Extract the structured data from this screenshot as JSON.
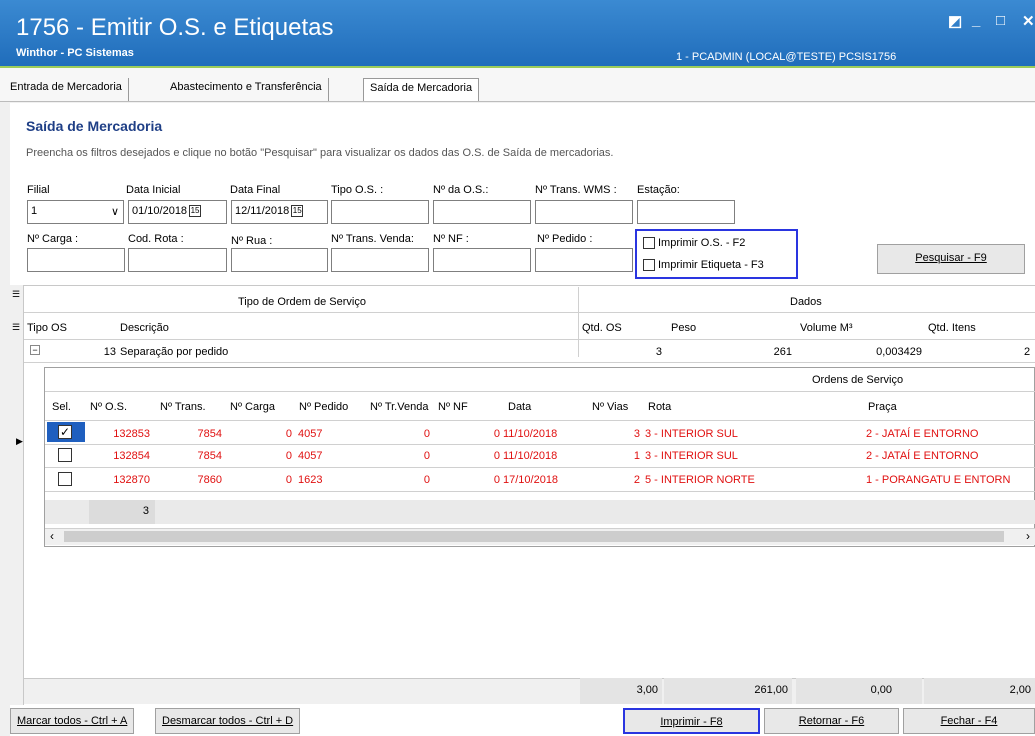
{
  "window": {
    "title": "1756 - Emitir O.S. e Etiquetas",
    "subtitle": "Winthor - PC Sistemas",
    "user_info": "1 - PCADMIN (LOCAL@TESTE)  PCSIS1756",
    "btn_min": "_",
    "btn_max": "□",
    "btn_close": "✕",
    "btn_restore": "◩"
  },
  "tabs": [
    "Entrada de Mercadoria",
    "Abastecimento e Transferência",
    "Saída de Mercadoria"
  ],
  "section": {
    "title": "Saída de Mercadoria",
    "description": "Preencha os filtros desejados e clique no botão \"Pesquisar\" para visualizar os dados das O.S. de Saída de mercadorias."
  },
  "filters": {
    "filial_label": "Filial",
    "filial_value": "1",
    "data_inicial_label": "Data Inicial",
    "data_inicial_value": "01/10/2018",
    "data_final_label": "Data Final",
    "data_final_value": "12/11/2018",
    "tipo_os_label": "Tipo O.S. :",
    "num_os_label": "Nº da O.S.:",
    "num_trans_wms_label": "Nº Trans. WMS :",
    "estacao_label": "Estação:",
    "num_carga_label": "Nº Carga :",
    "cod_rota_label": "Cod. Rota :",
    "num_rua_label": "Nº Rua :",
    "num_trans_venda_label": "Nº Trans. Venda:",
    "num_nf_label": "Nº NF :",
    "num_pedido_label": "Nº Pedido :",
    "imprimir_os_label": "Imprimir O.S. - F2",
    "imprimir_etiqueta_label": "Imprimir Etiqueta - F3",
    "pesquisar_label": "Pesquisar - F9",
    "calendar_glyph": "15"
  },
  "grid": {
    "group_header_left": "Tipo de Ordem de Serviço",
    "group_header_right": "Dados",
    "columns": [
      "Tipo OS",
      "Descrição",
      "Qtd. OS",
      "Peso",
      "Volume M³",
      "Qtd. Itens"
    ],
    "group_row": {
      "tipo": "13",
      "descricao": "Separação por pedido",
      "qtd_os": "3",
      "peso": "261",
      "volume": "0,003429",
      "qtd_itens": "2"
    },
    "detail_title": "Ordens de Serviço",
    "detail_columns": [
      "Sel.",
      "Nº O.S.",
      "Nº Trans.",
      "Nº Carga",
      "Nº Pedido",
      "Nº Tr.Venda",
      "Nº NF",
      "Data",
      "Nº Vias",
      "Rota",
      "Praça"
    ],
    "detail_rows": [
      {
        "checked": true,
        "os": "132853",
        "trans": "7854",
        "carga": "0",
        "pedido": "4057",
        "trvenda": "0",
        "nf": "0",
        "data": "11/10/2018",
        "vias": "3",
        "rota": "3 - INTERIOR SUL",
        "praca": "2 - JATAÍ E ENTORNO"
      },
      {
        "checked": false,
        "os": "132854",
        "trans": "7854",
        "carga": "0",
        "pedido": "4057",
        "trvenda": "0",
        "nf": "0",
        "data": "11/10/2018",
        "vias": "1",
        "rota": "3 - INTERIOR SUL",
        "praca": "2 - JATAÍ E ENTORNO"
      },
      {
        "checked": false,
        "os": "132870",
        "trans": "7860",
        "carga": "0",
        "pedido": "1623",
        "trvenda": "0",
        "nf": "0",
        "data": "17/10/2018",
        "vias": "2",
        "rota": "5 - INTERIOR NORTE",
        "praca": "1 - PORANGATU E ENTORN"
      }
    ],
    "detail_count": "3",
    "totals": {
      "qtd_os": "3,00",
      "peso": "261,00",
      "volume": "0,00",
      "qtd_itens": "2,00"
    }
  },
  "footer": {
    "marcar": "Marcar todos - Ctrl + A",
    "desmarcar": "Desmarcar todos - Ctrl + D",
    "imprimir": "Imprimir - F8",
    "retornar": "Retornar - F6",
    "fechar": "Fechar - F4"
  },
  "colors": {
    "title_bar": "#2a78c6",
    "highlight": "#2a35e0",
    "red_text": "#e01010",
    "section_title": "#1f3f86"
  }
}
